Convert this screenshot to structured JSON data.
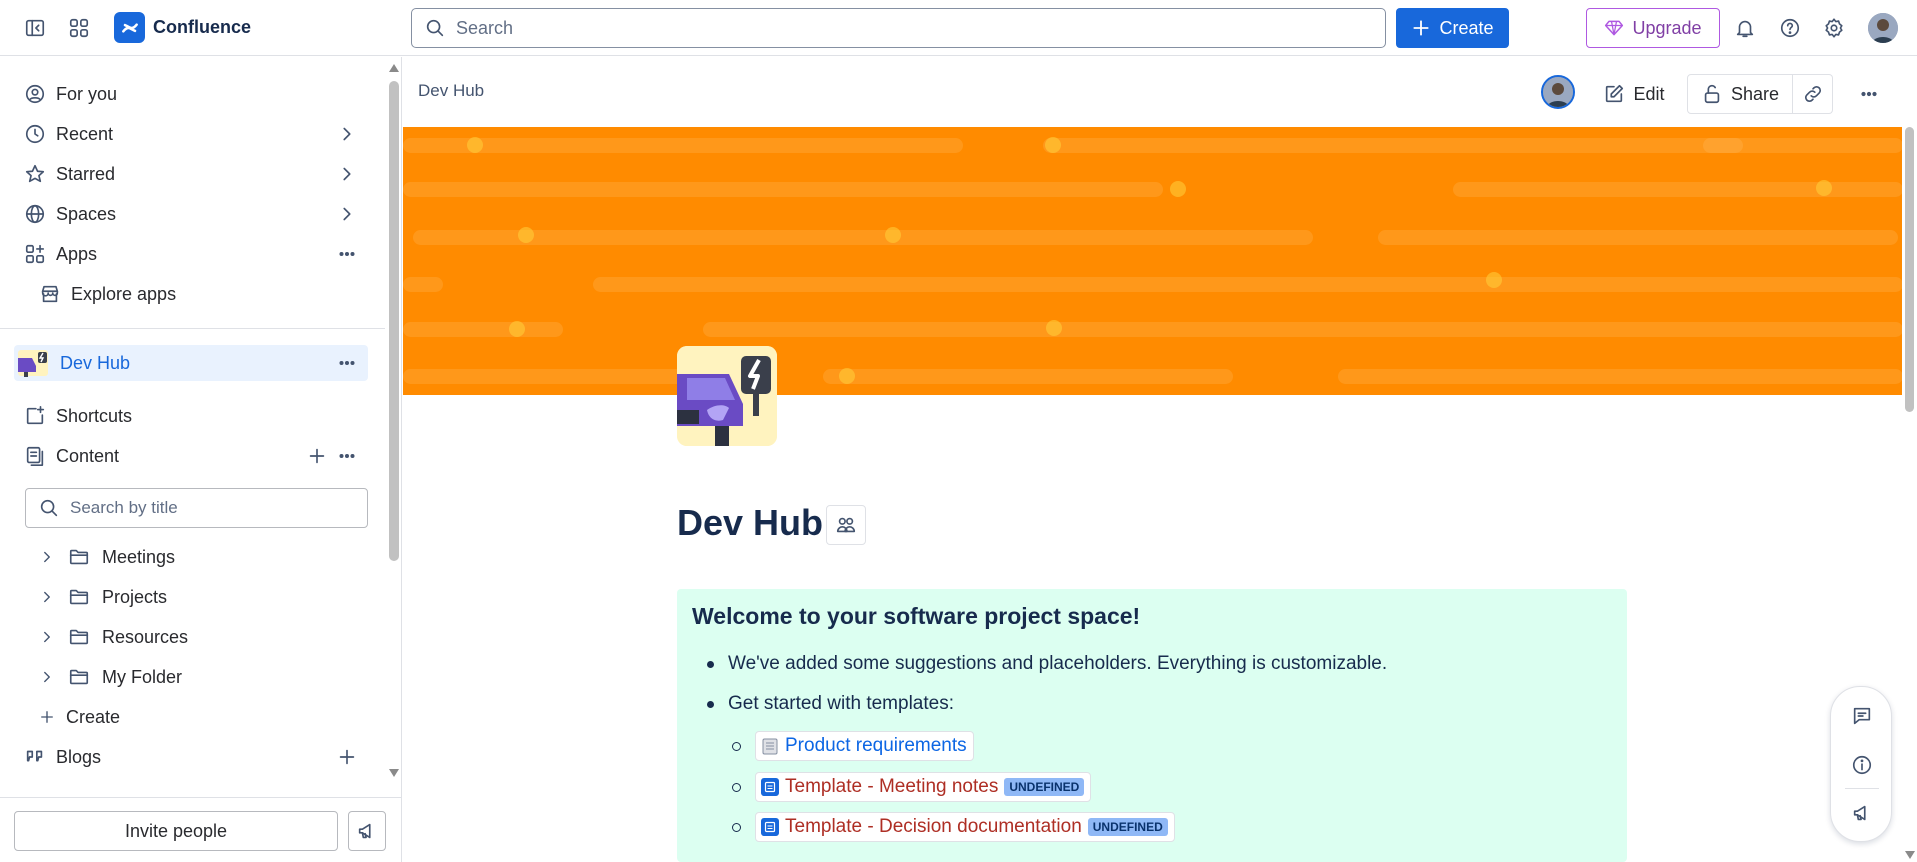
{
  "app": {
    "name": "Confluence"
  },
  "topbar": {
    "search_placeholder": "Search",
    "create_label": "Create",
    "upgrade_label": "Upgrade"
  },
  "sidebar": {
    "nav": [
      {
        "label": "For you"
      },
      {
        "label": "Recent"
      },
      {
        "label": "Starred"
      },
      {
        "label": "Spaces"
      },
      {
        "label": "Apps"
      },
      {
        "label": "Explore apps"
      }
    ],
    "space": {
      "name": "Dev Hub"
    },
    "shortcuts_label": "Shortcuts",
    "content_label": "Content",
    "title_search_placeholder": "Search by title",
    "tree": [
      {
        "label": "Meetings"
      },
      {
        "label": "Projects"
      },
      {
        "label": "Resources"
      },
      {
        "label": "My Folder"
      }
    ],
    "create_label": "Create",
    "blogs_label": "Blogs",
    "invite_label": "Invite people"
  },
  "page": {
    "breadcrumb": "Dev Hub",
    "edit_label": "Edit",
    "share_label": "Share",
    "title": "Dev Hub",
    "banner_color": "#ff8b00",
    "panel": {
      "heading": "Welcome to your software project space!",
      "bullet1": "We've added some suggestions and placeholders. Everything is customizable.",
      "bullet2": "Get started with templates:",
      "templates": [
        {
          "label": "Product requirements",
          "lozenge": ""
        },
        {
          "label": "Template - Meeting notes",
          "lozenge": "UNDEFINED"
        },
        {
          "label": "Template - Decision documentation",
          "lozenge": "UNDEFINED"
        }
      ]
    }
  },
  "colors": {
    "accent": "#1868db",
    "upgrade": "#803fa5",
    "panel_bg": "#dcfff1"
  }
}
